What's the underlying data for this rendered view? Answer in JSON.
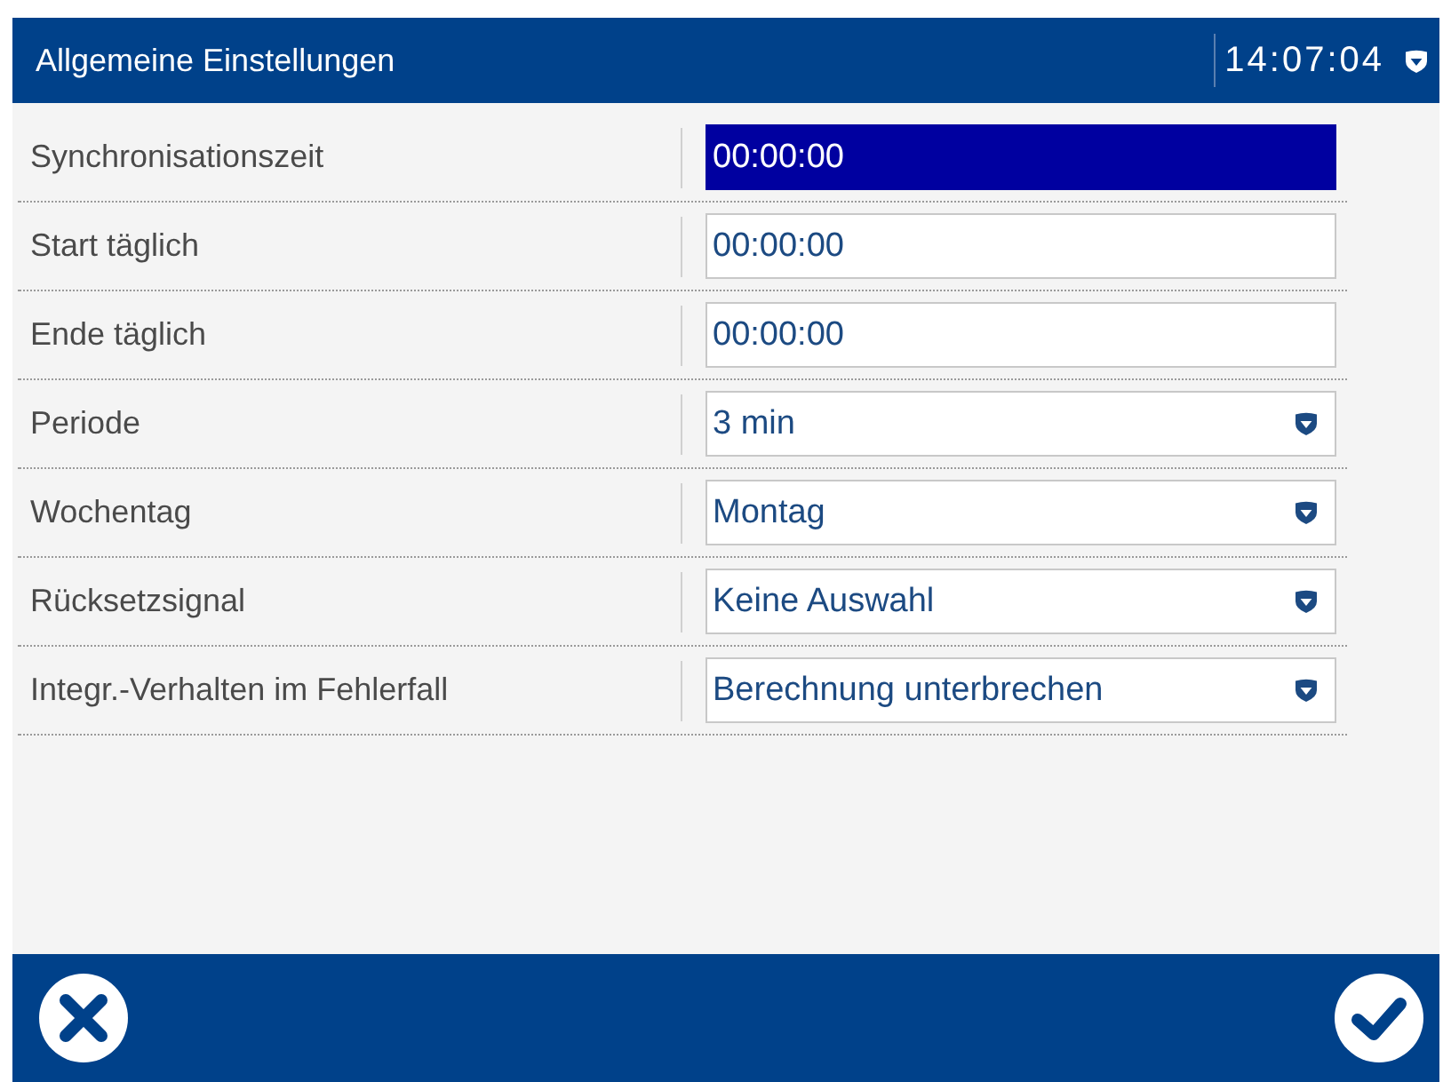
{
  "header": {
    "title": "Allgemeine Einstellungen",
    "clock": "14:07:04"
  },
  "settings": [
    {
      "label": "Synchronisationszeit",
      "kind": "time",
      "value": "00:00:00",
      "selected": true
    },
    {
      "label": "Start täglich",
      "kind": "time",
      "value": "00:00:00",
      "selected": false
    },
    {
      "label": "Ende täglich",
      "kind": "time",
      "value": "00:00:00",
      "selected": false
    },
    {
      "label": "Periode",
      "kind": "select",
      "value": "3 min",
      "selected": false
    },
    {
      "label": "Wochentag",
      "kind": "select",
      "value": "Montag",
      "selected": false
    },
    {
      "label": "Rücksetzsignal",
      "kind": "select",
      "value": "Keine Auswahl",
      "selected": false
    },
    {
      "label": "Integr.-Verhalten im Fehlerfall",
      "kind": "select",
      "value": "Berechnung unterbrechen",
      "selected": false
    }
  ]
}
